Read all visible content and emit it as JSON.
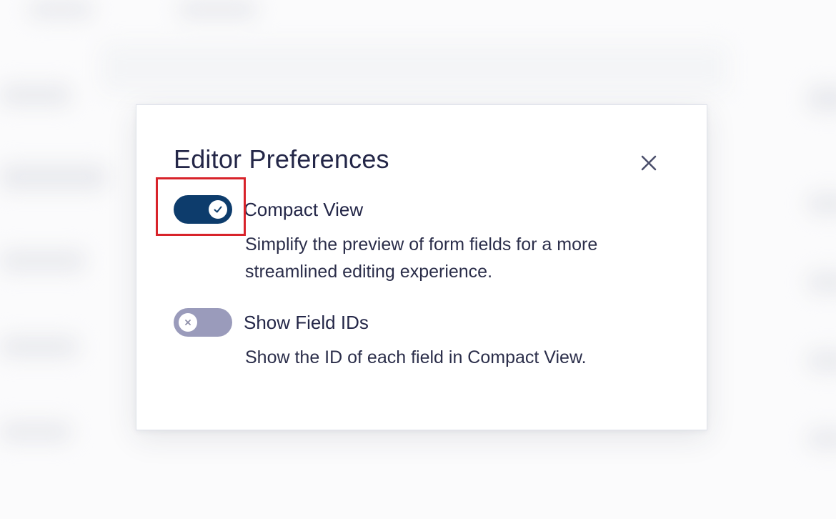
{
  "dialog": {
    "title": "Editor Preferences",
    "close_icon": "close-icon",
    "options": [
      {
        "label": "Compact View",
        "description": "Simplify the preview of form fields for a more streamlined editing experience.",
        "enabled": true,
        "knob_icon": "check-icon"
      },
      {
        "label": "Show Field IDs",
        "description": "Show the ID of each field in Compact View.",
        "enabled": false,
        "knob_icon": "x-icon"
      }
    ]
  },
  "colors": {
    "title_text": "#242748",
    "toggle_on": "#0d3c6c",
    "toggle_off": "#9a9bbb",
    "highlight": "#d8232a"
  }
}
